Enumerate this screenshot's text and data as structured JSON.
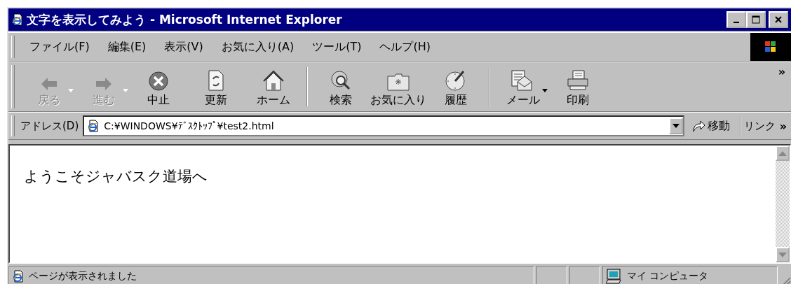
{
  "window": {
    "title": "文字を表示してみよう - Microsoft Internet Explorer"
  },
  "menu": [
    "ファイル(F)",
    "編集(E)",
    "表示(V)",
    "お気に入り(A)",
    "ツール(T)",
    "ヘルプ(H)"
  ],
  "toolbar": {
    "groups": [
      [
        {
          "kind": "back",
          "label": "戻る",
          "disabled": true,
          "dropdown": true
        },
        {
          "kind": "forward",
          "label": "進む",
          "disabled": true,
          "dropdown": true
        },
        {
          "kind": "stop",
          "label": "中止",
          "disabled": false,
          "dropdown": false
        },
        {
          "kind": "refresh",
          "label": "更新",
          "disabled": false,
          "dropdown": false
        },
        {
          "kind": "home",
          "label": "ホーム",
          "disabled": false,
          "dropdown": false
        }
      ],
      [
        {
          "kind": "search",
          "label": "検索",
          "disabled": false,
          "dropdown": false
        },
        {
          "kind": "favorites",
          "label": "お気に入り",
          "disabled": false,
          "dropdown": false
        },
        {
          "kind": "history",
          "label": "履歴",
          "disabled": false,
          "dropdown": false
        }
      ],
      [
        {
          "kind": "mail",
          "label": "メール",
          "disabled": false,
          "dropdown": true
        },
        {
          "kind": "print",
          "label": "印刷",
          "disabled": false,
          "dropdown": false
        }
      ]
    ],
    "more": "»"
  },
  "address_bar": {
    "label": "アドレス(D)",
    "value": "C:¥WINDOWS¥ﾃﾞｽｸﾄｯﾌﾟ¥test2.html",
    "go": "移動",
    "links": "リンク",
    "more": "»"
  },
  "page": {
    "text": "ようこそジャバスク道場へ"
  },
  "status_bar": {
    "text": "ページが表示されました",
    "zone": "マイ コンピュータ"
  }
}
